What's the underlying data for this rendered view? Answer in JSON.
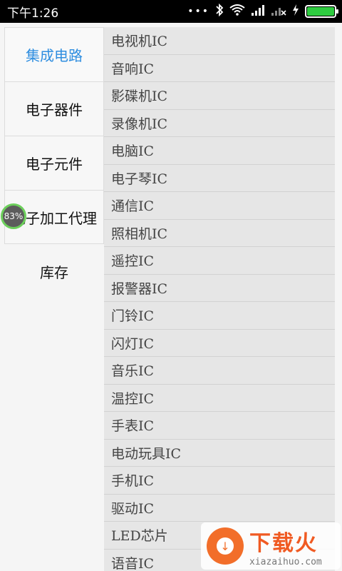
{
  "status_bar": {
    "time": "下午1:26",
    "dots": "•••",
    "battery_color": "#2ecc40"
  },
  "categories": [
    {
      "label": "集成电路",
      "active": true
    },
    {
      "label": "电子器件",
      "active": false
    },
    {
      "label": "电子元件",
      "active": false
    },
    {
      "label": "电子加工代理",
      "active": false
    },
    {
      "label": "库存",
      "active": false
    }
  ],
  "items": [
    "电视机IC",
    "音响IC",
    "影碟机IC",
    "录像机IC",
    "电脑IC",
    "电子琴IC",
    "通信IC",
    "照相机IC",
    "遥控IC",
    "报警器IC",
    "门铃IC",
    "闪灯IC",
    "音乐IC",
    "温控IC",
    "手表IC",
    "电动玩具IC",
    "手机IC",
    "驱动IC",
    "LED芯片",
    "语音IC"
  ],
  "overlay": {
    "bubble_text": "83%"
  },
  "watermark": {
    "title": "下载火",
    "domain": "xiazaihuo.com"
  },
  "colors": {
    "accent": "#2f8ee0",
    "list_bg": "#e6e6e6"
  }
}
